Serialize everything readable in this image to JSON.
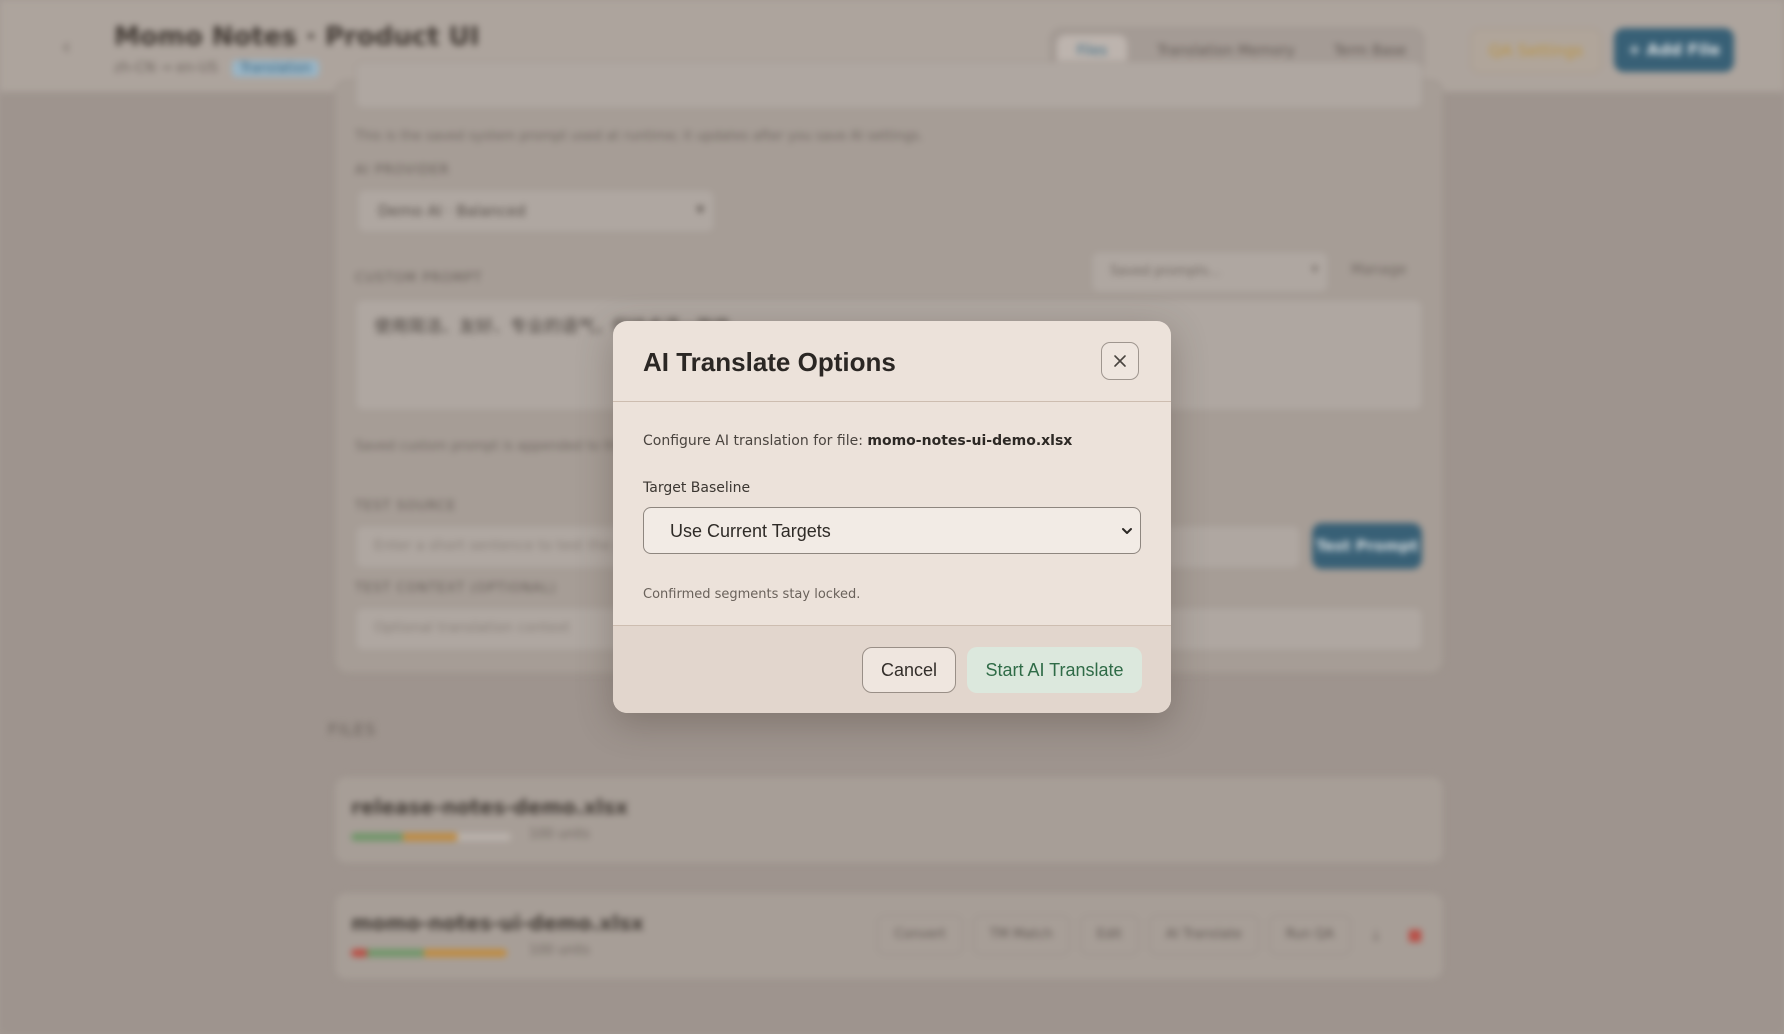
{
  "header": {
    "back_icon": "chevron-left-icon",
    "title": "Momo Notes · Product UI",
    "subtitle": "zh-CN → en-US",
    "badge": "Translation",
    "tabs": [
      {
        "label": "Files",
        "active": true
      },
      {
        "label": "Translation Memory",
        "active": false
      },
      {
        "label": "Term Base",
        "active": false
      }
    ],
    "qa_settings_label": "QA Settings",
    "add_file_label": "+ Add File"
  },
  "settings": {
    "system_prompt_hint": "This is the saved system prompt used at runtime; it updates after you save AI settings.",
    "ai_provider_label": "AI PROVIDER",
    "ai_provider_value": "Demo AI · Balanced",
    "custom_prompt_label": "CUSTOM PROMPT",
    "saved_prompts_placeholder": "Saved prompts...",
    "manage_label": "Manage",
    "custom_prompt_value": "使用简洁、友好、专业的语气，保持术语一致性。",
    "custom_prompt_hint": "Saved custom prompt is appended to the system prompt.",
    "test_source_label": "TEST SOURCE",
    "test_source_placeholder": "Enter a short sentence to test the prompt",
    "test_prompt_label": "Test Prompt",
    "test_context_label": "TEST CONTEXT (OPTIONAL)",
    "test_context_placeholder": "Optional translation context"
  },
  "files": {
    "section_label": "FILES",
    "items": [
      {
        "name": "release-notes-demo.xlsx",
        "meta": "100 units",
        "progress": {
          "confirmed": 0.38,
          "translated": 0.39,
          "total_width_frac": 1.0
        }
      },
      {
        "name": "momo-notes-ui-demo.xlsx",
        "meta": "100 units",
        "progress": {
          "error": 0.1,
          "confirmed": 0.37,
          "translated": 0.53
        },
        "actions": [
          "Convert",
          "TM Match",
          "Edit",
          "AI Translate",
          "Run QA"
        ]
      }
    ]
  },
  "modal": {
    "title": "AI Translate Options",
    "close_icon": "close-icon",
    "description_prefix": "Configure AI translation for file: ",
    "file_name": "momo-notes-ui-demo.xlsx",
    "target_baseline_label": "Target Baseline",
    "target_baseline_value": "Use Current Targets",
    "hint": "Confirmed segments stay locked.",
    "cancel_label": "Cancel",
    "start_label": "Start AI Translate"
  },
  "colors": {
    "accent_blue": "#2f5f79",
    "primary_green": "#2f6b47",
    "primary_green_bg": "#dce8dd",
    "progress_green": "#6f9d6a",
    "progress_orange": "#c9913e",
    "progress_red": "#c2493f",
    "delete_red": "#c24a42"
  }
}
